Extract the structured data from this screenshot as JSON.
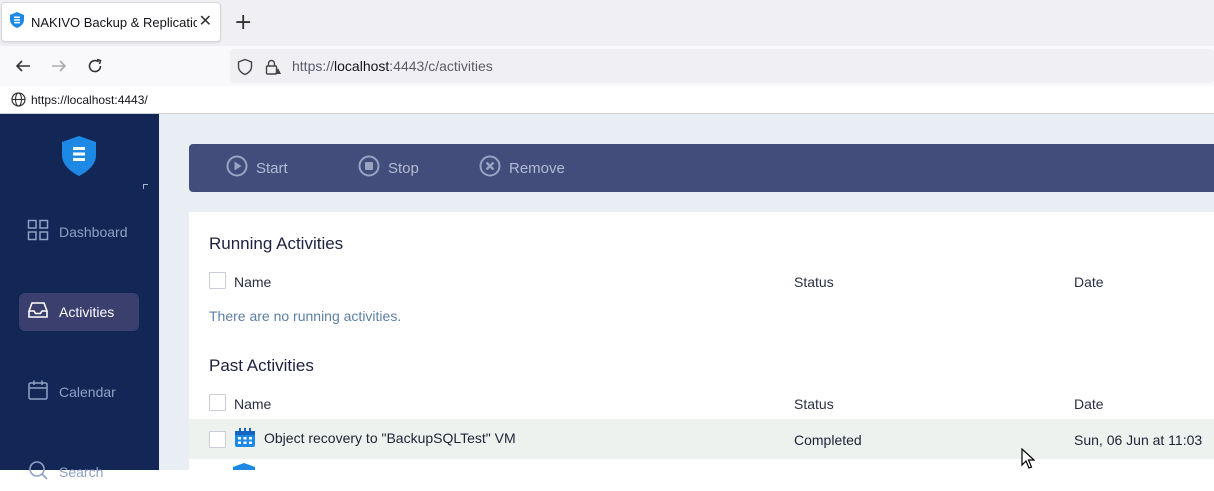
{
  "browser": {
    "tab_title": "NAKIVO Backup & Replication",
    "url_scheme": "https://",
    "url_host": "localhost",
    "url_rest": ":4443/c/activities",
    "status_url": "https://localhost:4443/"
  },
  "sidebar": {
    "items": [
      {
        "label": "Dashboard",
        "icon": "grid-icon",
        "active": false
      },
      {
        "label": "Activities",
        "icon": "inbox-icon",
        "active": true
      },
      {
        "label": "Calendar",
        "icon": "calendar-icon",
        "active": false
      },
      {
        "label": "Search",
        "icon": "search-icon",
        "active": false
      }
    ]
  },
  "toolbar": {
    "start_label": "Start",
    "stop_label": "Stop",
    "remove_label": "Remove"
  },
  "running": {
    "title": "Running Activities",
    "col_name": "Name",
    "col_status": "Status",
    "col_date": "Date",
    "empty_message": "There are no running activities."
  },
  "past": {
    "title": "Past Activities",
    "col_name": "Name",
    "col_status": "Status",
    "col_date": "Date",
    "rows": [
      {
        "name": "Object recovery to \"BackupSQLTest\" VM",
        "status": "Completed",
        "date": "Sun, 06 Jun at 11:03"
      }
    ]
  },
  "colors": {
    "sidebar_bg": "#122756",
    "toolbar_bg": "#424d7c",
    "accent": "#1e88e5"
  }
}
